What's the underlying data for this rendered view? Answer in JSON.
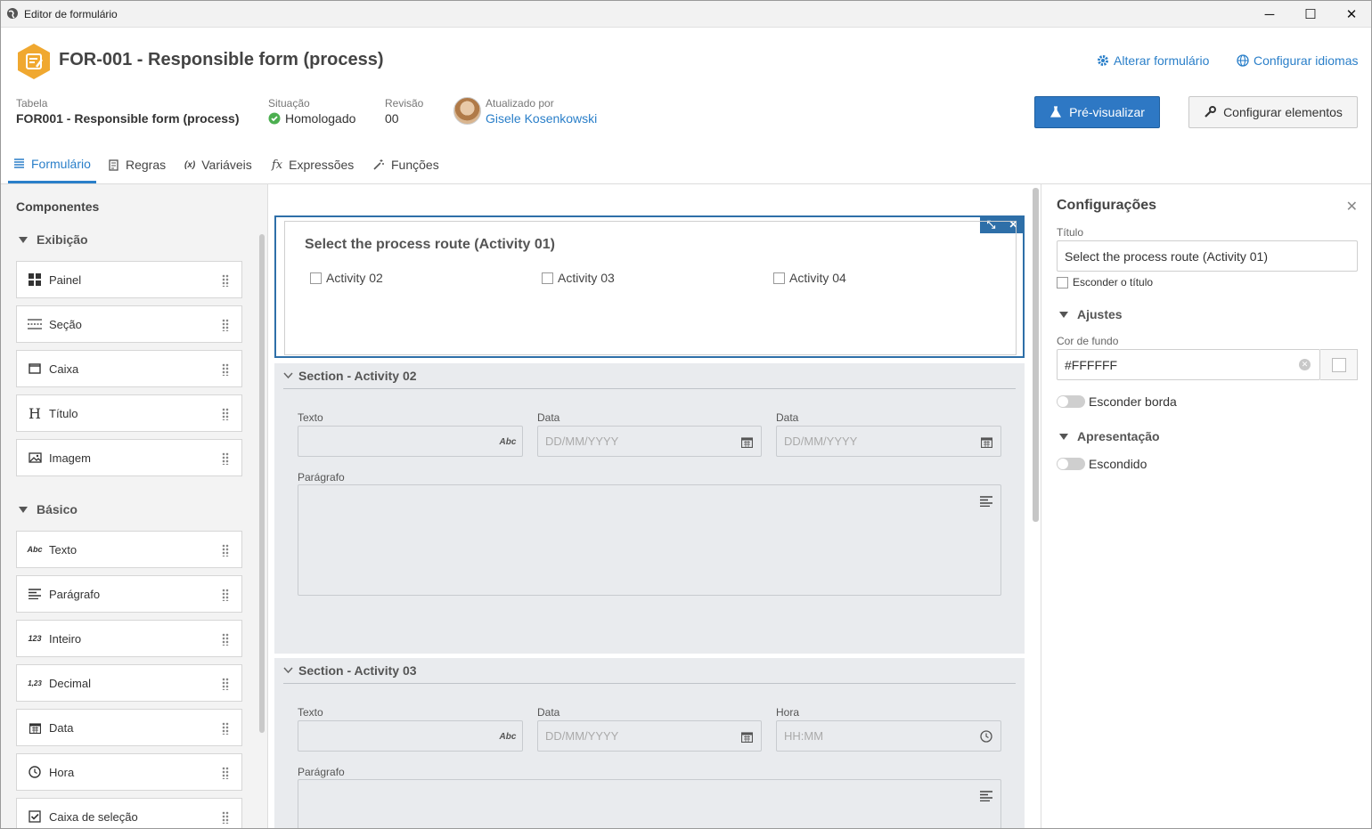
{
  "window": {
    "title": "Editor de formulário",
    "minimize": "─",
    "maximize": "☐",
    "close": "✕"
  },
  "header": {
    "form_title": "FOR-001 - Responsible form (process)",
    "links": {
      "change_form": "Alterar formulário",
      "configure_languages": "Configurar idiomas"
    },
    "meta": {
      "table_label": "Tabela",
      "table_value": "FOR001 - Responsible form (process)",
      "status_label": "Situação",
      "status_value": "Homologado",
      "revision_label": "Revisão",
      "revision_value": "00",
      "updated_label": "Atualizado por",
      "updated_value": "Gisele Kosenkowski"
    },
    "buttons": {
      "preview": "Pré-visualizar",
      "configure_elements": "Configurar elementos"
    }
  },
  "tabs": [
    {
      "label": "Formulário",
      "active": true
    },
    {
      "label": "Regras"
    },
    {
      "label": "Variáveis"
    },
    {
      "label": "Expressões"
    },
    {
      "label": "Funções"
    }
  ],
  "sidebar": {
    "title": "Componentes",
    "groups": [
      {
        "label": "Exibição",
        "items": [
          {
            "label": "Painel",
            "icon": "panel-icon"
          },
          {
            "label": "Seção",
            "icon": "section-icon"
          },
          {
            "label": "Caixa",
            "icon": "box-icon"
          },
          {
            "label": "Título",
            "icon": "heading-icon",
            "glyph": "H"
          },
          {
            "label": "Imagem",
            "icon": "image-icon"
          }
        ]
      },
      {
        "label": "Básico",
        "items": [
          {
            "label": "Texto",
            "icon": "text-icon",
            "glyph": "Abc"
          },
          {
            "label": "Parágrafo",
            "icon": "paragraph-icon"
          },
          {
            "label": "Inteiro",
            "icon": "integer-icon",
            "glyph": "123"
          },
          {
            "label": "Decimal",
            "icon": "decimal-icon",
            "glyph": "1,23"
          },
          {
            "label": "Data",
            "icon": "calendar-icon"
          },
          {
            "label": "Hora",
            "icon": "clock-icon"
          },
          {
            "label": "Caixa de seleção",
            "icon": "checkbox-icon"
          }
        ]
      }
    ]
  },
  "canvas": {
    "selected_field": {
      "title": "Select the process route (Activity 01)",
      "options": [
        "Activity 02",
        "Activity 03",
        "Activity 04"
      ]
    },
    "sections": [
      {
        "title": "Section - Activity 02",
        "fields": [
          {
            "label": "Texto",
            "placeholder": "",
            "icon_text": "Abc"
          },
          {
            "label": "Data",
            "placeholder": "DD/MM/YYYY"
          },
          {
            "label": "Data",
            "placeholder": "DD/MM/YYYY"
          }
        ],
        "paragraph_label": "Parágrafo"
      },
      {
        "title": "Section - Activity 03",
        "fields": [
          {
            "label": "Texto",
            "placeholder": "",
            "icon_text": "Abc"
          },
          {
            "label": "Data",
            "placeholder": "DD/MM/YYYY"
          },
          {
            "label": "Hora",
            "placeholder": "HH:MM"
          }
        ],
        "paragraph_label": "Parágrafo"
      }
    ]
  },
  "settings": {
    "title": "Configurações",
    "close": "✕",
    "title_label": "Título",
    "title_value": "Select the process route (Activity 01)",
    "hide_title": "Esconder o título",
    "adjustments_group": "Ajustes",
    "bg_color_label": "Cor de fundo",
    "bg_color_value": "#FFFFFF",
    "hide_border": "Esconder borda",
    "presentation_group": "Apresentação",
    "hidden": "Escondido"
  },
  "colors": {
    "accent": "#2a7fc9",
    "primary_button": "#2e78c4",
    "status_ok": "#4caf50",
    "logo": "#f0a830"
  }
}
